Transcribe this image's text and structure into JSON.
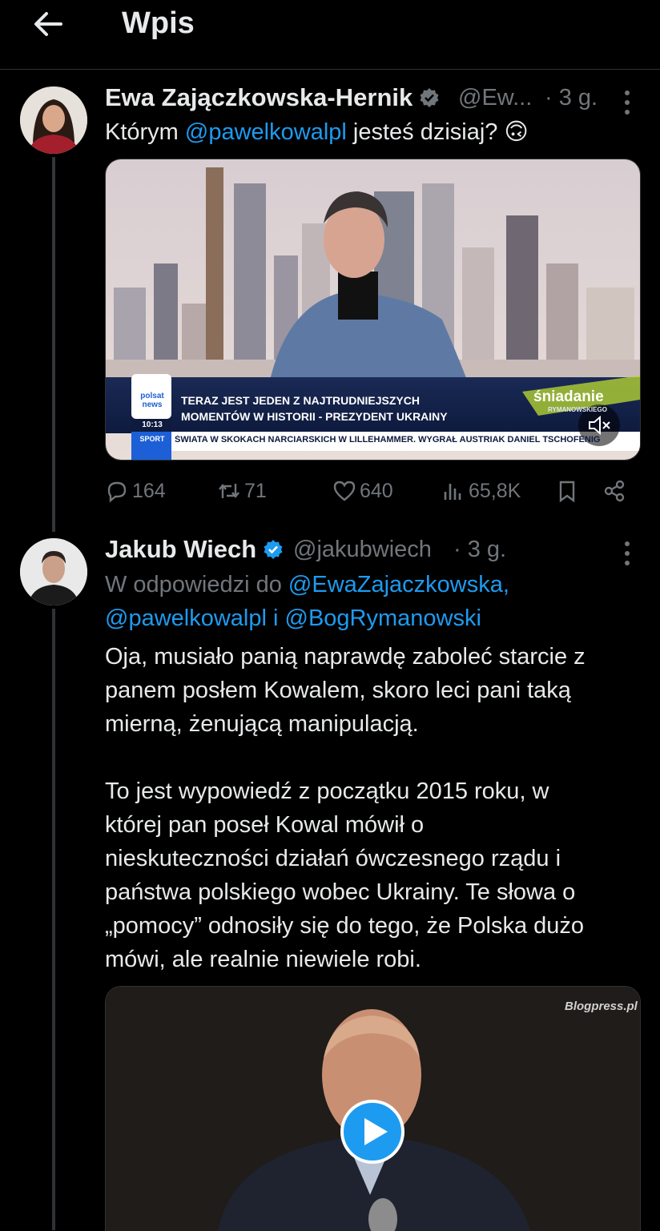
{
  "header": {
    "title": "Wpis"
  },
  "post1": {
    "author_name": "Ewa Zajączkowska-Hernik",
    "author_handle": "@Ew...",
    "time": "· 3 g.",
    "text_before": "Którym ",
    "text_mention": "@pawelkowalpl",
    "text_after": " jesteś dzisiaj? 🙃",
    "video": {
      "channel_logo_text": "polsat news",
      "clock": "10:13",
      "sport_label": "SPORT",
      "headline_line1": "TERAZ JEST JEDEN Z NAJTRUDNIEJSZYCH",
      "headline_line2": "MOMENTÓW W HISTORII - PREZYDENT UKRAINY",
      "show_title": "śniadanie",
      "show_subtitle": "RYMANOWSKIEGO",
      "ticker": "ŚWIATA W SKOKACH NARCIARSKICH W LILLEHAMMER. WYGRAŁ AUSTRIAK DANIEL TSCHOFENIG"
    },
    "stats": {
      "replies": "164",
      "reposts": "71",
      "likes": "640",
      "views": "65,8K"
    }
  },
  "post2": {
    "author_name": "Jakub Wiech",
    "author_handle": "@jakubwiech",
    "time": "· 3 g.",
    "reply_prefix": "W odpowiedzi do ",
    "reply_to_line1": "@EwaZajaczkowska,",
    "reply_to_line2a": "@pawelkowalpl",
    "reply_and": " i ",
    "reply_to_line2b": "@BogRymanowski",
    "paragraph1": [
      "Oja, musiało panią naprawdę zaboleć starcie z",
      "panem posłem Kowalem, skoro leci pani taką",
      "mierną, żenującą manipulacją."
    ],
    "paragraph2": [
      "To jest wypowiedź z początku 2015 roku, w",
      "której pan poseł Kowal mówił o",
      "nieskuteczności działań ówczesnego rządu i",
      "państwa polskiego wobec Ukrainy. Te słowa o",
      "„pomocy” odnosiły się do tego, że Polska dużo",
      "mówi, ale realnie niewiele robi."
    ],
    "video_watermark": "Blogpress.pl"
  },
  "colors": {
    "accent": "#1d9bf0",
    "muted": "#71767b",
    "background": "#000000"
  }
}
